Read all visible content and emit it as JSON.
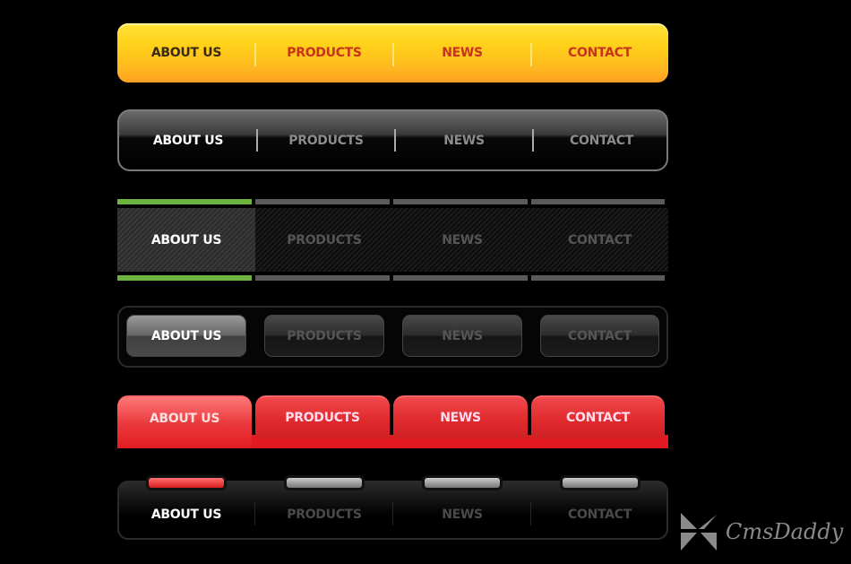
{
  "nav_labels": [
    "ABOUT US",
    "PRODUCTS",
    "NEWS",
    "CONTACT"
  ],
  "menus": [
    {
      "style": "yellow",
      "active_index": 0,
      "items": [
        "ABOUT US",
        "PRODUCTS",
        "NEWS",
        "CONTACT"
      ]
    },
    {
      "style": "glossy-black",
      "active_index": 0,
      "items": [
        "ABOUT US",
        "PRODUCTS",
        "NEWS",
        "CONTACT"
      ]
    },
    {
      "style": "carbon",
      "active_index": 0,
      "items": [
        "ABOUT US",
        "PRODUCTS",
        "NEWS",
        "CONTACT"
      ]
    },
    {
      "style": "black-buttons",
      "active_index": 0,
      "items": [
        "ABOUT US",
        "PRODUCTS",
        "NEWS",
        "CONTACT"
      ]
    },
    {
      "style": "red-tabs",
      "active_index": 0,
      "items": [
        "ABOUT US",
        "PRODUCTS",
        "NEWS",
        "CONTACT"
      ]
    },
    {
      "style": "indicator-pills",
      "active_index": 0,
      "items": [
        "ABOUT US",
        "PRODUCTS",
        "NEWS",
        "CONTACT"
      ]
    }
  ],
  "colors": {
    "yellow": "#ffd21a",
    "red": "#e2191e",
    "green": "#6db33f",
    "background": "#000000"
  },
  "watermark": {
    "text": "CmsDaddy"
  }
}
